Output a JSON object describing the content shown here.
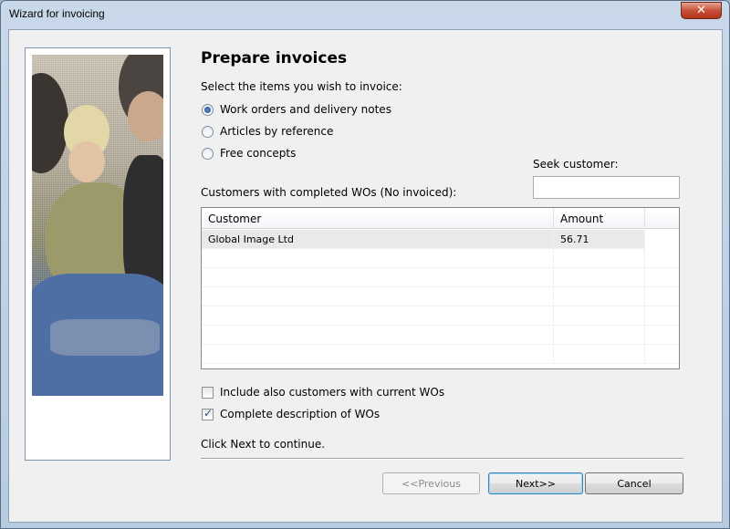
{
  "window": {
    "title": "Wizard for invoicing",
    "close_glyph": "✕"
  },
  "page": {
    "heading": "Prepare invoices",
    "instruction": "Select the items you wish to invoice:",
    "options": [
      {
        "label": "Work orders and delivery notes",
        "selected": true
      },
      {
        "label": "Articles by reference",
        "selected": false
      },
      {
        "label": "Free concepts",
        "selected": false
      }
    ],
    "seek_label": "Seek customer:",
    "seek_value": "",
    "customers_label": "Customers with completed WOs (No invoiced):"
  },
  "grid": {
    "columns": [
      "Customer",
      "Amount"
    ],
    "rows": [
      {
        "customer": "Global Image Ltd",
        "amount": "56.71"
      }
    ]
  },
  "checks": [
    {
      "label": "Include also customers with current WOs",
      "checked": false
    },
    {
      "label": "Complete description of WOs",
      "checked": true
    }
  ],
  "check_glyph": "✓",
  "footer": {
    "hint": "Click Next to continue.",
    "previous_label": "<<Previous",
    "next_label": "Next>>",
    "cancel_label": "Cancel"
  }
}
